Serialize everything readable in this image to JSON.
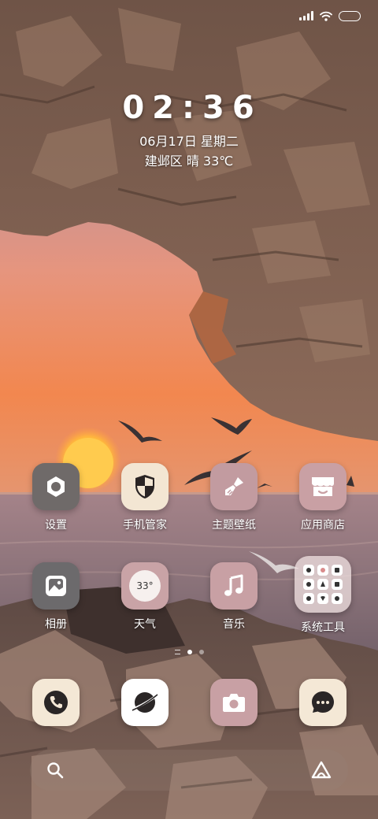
{
  "status_bar": {
    "battery_icon": "battery-icon",
    "wifi_icon": "wifi-icon",
    "signal_icon": "signal-icon"
  },
  "lock_clock": {
    "time": "02:36",
    "date": "06月17日 星期二",
    "weather": "建邺区 晴 33℃"
  },
  "apps_row1": [
    {
      "label": "设置",
      "icon": "gear-icon"
    },
    {
      "label": "手机管家",
      "icon": "shield-icon"
    },
    {
      "label": "主题壁纸",
      "icon": "paintbrush-icon"
    },
    {
      "label": "应用商店",
      "icon": "store-icon"
    }
  ],
  "apps_row2": [
    {
      "label": "相册",
      "icon": "gallery-icon"
    },
    {
      "label": "天气",
      "icon": "weather-icon",
      "badge": "33°"
    },
    {
      "label": "音乐",
      "icon": "music-note-icon"
    },
    {
      "label": "系统工具",
      "icon": "folder-icon"
    }
  ],
  "dock": [
    {
      "icon": "phone-icon"
    },
    {
      "icon": "browser-icon"
    },
    {
      "icon": "camera-icon"
    },
    {
      "icon": "messages-icon"
    }
  ],
  "search_bar": {
    "search_icon": "search-icon",
    "assistant_icon": "assistant-icon"
  },
  "colors": {
    "rock": "#8a6b5c",
    "sky_top": "#9a8c9e",
    "sky_sunset": "#f08a5a",
    "sea": "#8c7478",
    "icon_bg_light": "#f4e8da",
    "icon_bg_pink": "#c9a1a5"
  }
}
